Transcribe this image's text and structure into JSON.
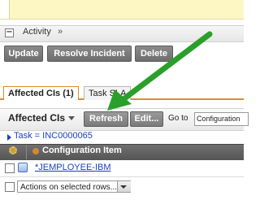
{
  "activity": {
    "label": "Activity",
    "expand_glyph": "»",
    "collapse_glyph": "−"
  },
  "actions": {
    "update_label": "Update",
    "resolve_label": "Resolve Incident",
    "delete_label": "Delete"
  },
  "tabs": [
    {
      "label": "Affected CIs (1)",
      "active": true
    },
    {
      "label": "Task SLA",
      "active": false
    }
  ],
  "related_list": {
    "title": "Affected CIs",
    "refresh_label": "Refresh",
    "edit_label": "Edit...",
    "goto_label": "Go to",
    "goto_value": "Configuration"
  },
  "breadcrumb": "Task = INC0000065",
  "table": {
    "columns": [
      "Configuration Item"
    ],
    "rows": [
      {
        "configuration_item": "*JEMPLOYEE-IBM"
      }
    ]
  },
  "row_actions": {
    "value": "Actions on selected rows..."
  },
  "icons": {
    "activity_collapse": "collapse-box-icon",
    "activity_expand": "double-chevron-right-icon",
    "list_menu": "triangle-down-icon",
    "breadcrumb": "triangle-right-icon",
    "column_settings": "gear-icon",
    "column_sort": "sort-circle-icon",
    "row_item": "configuration-item-icon",
    "select_arrow": "triangle-down-icon"
  },
  "colors": {
    "annotation_arrow": "#2aa02a",
    "tab_accent": "#e08a2a",
    "link": "#1a3fbf"
  }
}
